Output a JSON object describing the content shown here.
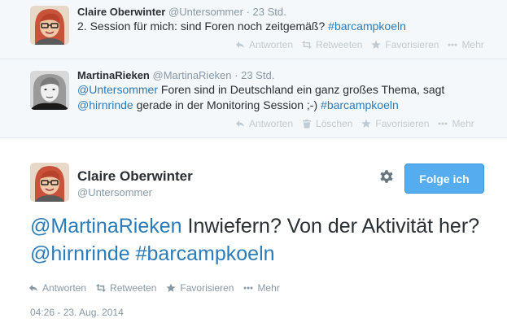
{
  "tweets": [
    {
      "name": "Claire Oberwinter",
      "handle": "@Untersommer",
      "dot": "·",
      "time": "23 Std.",
      "text_plain": "2. Session für mich: sind Foren noch zeitgemäß?",
      "hashtag": "#barcampkoeln",
      "actions": [
        "Antworten",
        "Retweeten",
        "Favorisieren",
        "Mehr"
      ]
    },
    {
      "name": "MartinaRieken",
      "handle": "@MartinaRieken",
      "dot": "·",
      "time": "23 Std.",
      "mention1": "@Untersommer",
      "text1": " Foren sind in Deutschland  ein ganz großes Thema, sagt",
      "mention2": "@hirnrinde",
      "text2": " gerade in der Monitoring Session ;-) ",
      "hashtag": "#barcampkoeln",
      "actions": [
        "Antworten",
        "Löschen",
        "Favorisieren",
        "Mehr"
      ]
    }
  ],
  "main": {
    "name": "Claire Oberwinter",
    "handle": "@Untersommer",
    "follow_label": "Folge ich",
    "mention": "@MartinaRieken",
    "text": " Inwiefern? Von der Aktivität her? ",
    "mention2": "@hirnrinde",
    "hashtag": " #barcampkoeln",
    "actions": [
      "Antworten",
      "Retweeten",
      "Favorisieren",
      "Mehr"
    ],
    "timestamp": "04:26 - 23. Aug. 2014"
  },
  "colors": {
    "link": "#2b7bb9",
    "follow_button": "#55acee",
    "context_bg": "#f5f8fa"
  },
  "icons": [
    "reply-icon",
    "retweet-icon",
    "trash-icon",
    "star-icon",
    "more-icon",
    "gear-icon"
  ]
}
